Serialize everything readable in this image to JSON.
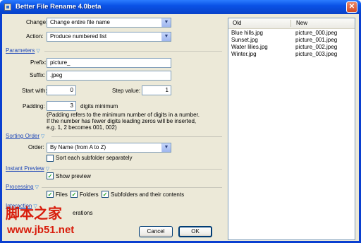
{
  "window": {
    "title": "Better File Rename 4.0beta",
    "close_glyph": "✕"
  },
  "change": {
    "label": "Change:",
    "value": "Change entire file name"
  },
  "action": {
    "label": "Action:",
    "value": "Produce numbered list"
  },
  "parameters": {
    "title": "Parameters",
    "prefix_label": "Prefix:",
    "prefix_value": "picture_",
    "suffix_label": "Suffix:",
    "suffix_value": ".jpeg",
    "start_label": "Start with:",
    "start_value": "0",
    "step_label": "Step value:",
    "step_value": "1",
    "padding_label": "Padding:",
    "padding_value": "3",
    "padding_unit": "digits minimum",
    "note_line1": "(Padding refers to the minimum number of digits in a number.",
    "note_line2": "If the number has fewer digits leading zeros will be inserted,",
    "note_line3": "e.g. 1, 2 becomes 001, 002)"
  },
  "sorting": {
    "title": "Sorting Order",
    "order_label": "Order:",
    "order_value": "By Name (from A to Z)",
    "subfolder_label": "Sort each subfolder separately",
    "subfolder_checked": false
  },
  "preview": {
    "title": "Instant Preview",
    "show_label": "Show preview",
    "show_checked": true
  },
  "processing": {
    "title": "Processing",
    "files_label": "Files",
    "folders_label": "Folders",
    "subfolders_label": "Subfolders and their contents"
  },
  "interaction": {
    "title": "Interaction",
    "partial_text": "erations"
  },
  "buttons": {
    "cancel": "Cancel",
    "ok": "OK"
  },
  "list": {
    "headers": [
      "Old",
      "New"
    ],
    "rows": [
      {
        "old": "Blue hills.jpg",
        "new": "picture_000.jpeg"
      },
      {
        "old": "Sunset.jpg",
        "new": "picture_001.jpeg"
      },
      {
        "old": "Water lilies.jpg",
        "new": "picture_002.jpeg"
      },
      {
        "old": "Winter.jpg",
        "new": "picture_003.jpeg"
      }
    ]
  },
  "watermark": {
    "logo_text": "脚本之家",
    "url": "www.jb51.net"
  },
  "icons": {
    "dropdown": "chevron-down-icon",
    "section": "collapse-chevron-icon",
    "check": "checkmark-icon"
  },
  "colors": {
    "titlebar": "#0a52e6",
    "section_link": "#1f48b8",
    "watermark": "#d81d0c",
    "face": "#ece9d8"
  }
}
